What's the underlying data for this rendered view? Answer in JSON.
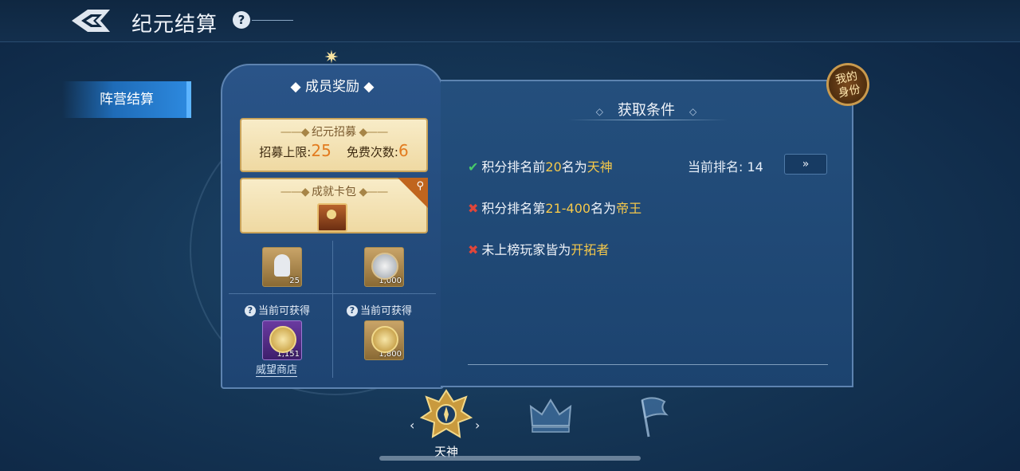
{
  "header": {
    "title": "纪元结算",
    "help_icon": "?"
  },
  "sidebar": {
    "items": [
      {
        "label": "阵营结算",
        "active": true
      }
    ]
  },
  "reward_panel": {
    "title": "成员奖励",
    "recruit_card": {
      "title": "纪元招募",
      "limit_label": "招募上限:",
      "limit_value": "25",
      "free_label": "免费次数:",
      "free_value": "6"
    },
    "achievement_card": {
      "title": "成就卡包"
    },
    "items": [
      {
        "name": "statue-item",
        "count": "25"
      },
      {
        "name": "silver-coin-item",
        "count": "1,000"
      },
      {
        "name": "prestige-coin-item",
        "count": "1,151"
      },
      {
        "name": "gold-coin-item",
        "count": "1,800"
      }
    ],
    "available_label": "当前可获得",
    "shop_link": "威望商店"
  },
  "conditions_panel": {
    "title": "获取条件",
    "conditions": [
      {
        "status": "met",
        "prefix": "积分排名前",
        "num": "20",
        "mid": "名为",
        "role": "天神"
      },
      {
        "status": "unmet",
        "prefix": "积分排名第",
        "num": "21-400",
        "mid": "名为",
        "role": "帝王"
      },
      {
        "status": "unmet",
        "prefix": "未上榜玩家皆为",
        "num": "",
        "mid": "",
        "role": "开拓者"
      }
    ],
    "current_rank_label": "当前排名:",
    "current_rank_value": "14",
    "rank_button": "»"
  },
  "identity_badge": {
    "line1": "我的",
    "line2": "身份"
  },
  "ranks": [
    {
      "label": "天神",
      "selected": true
    },
    {
      "label": "",
      "selected": false
    },
    {
      "label": "",
      "selected": false
    }
  ],
  "colors": {
    "highlight": "#f5c84a",
    "met": "#47c96a",
    "unmet": "#e0463a",
    "accent": "#2d8ae0"
  }
}
